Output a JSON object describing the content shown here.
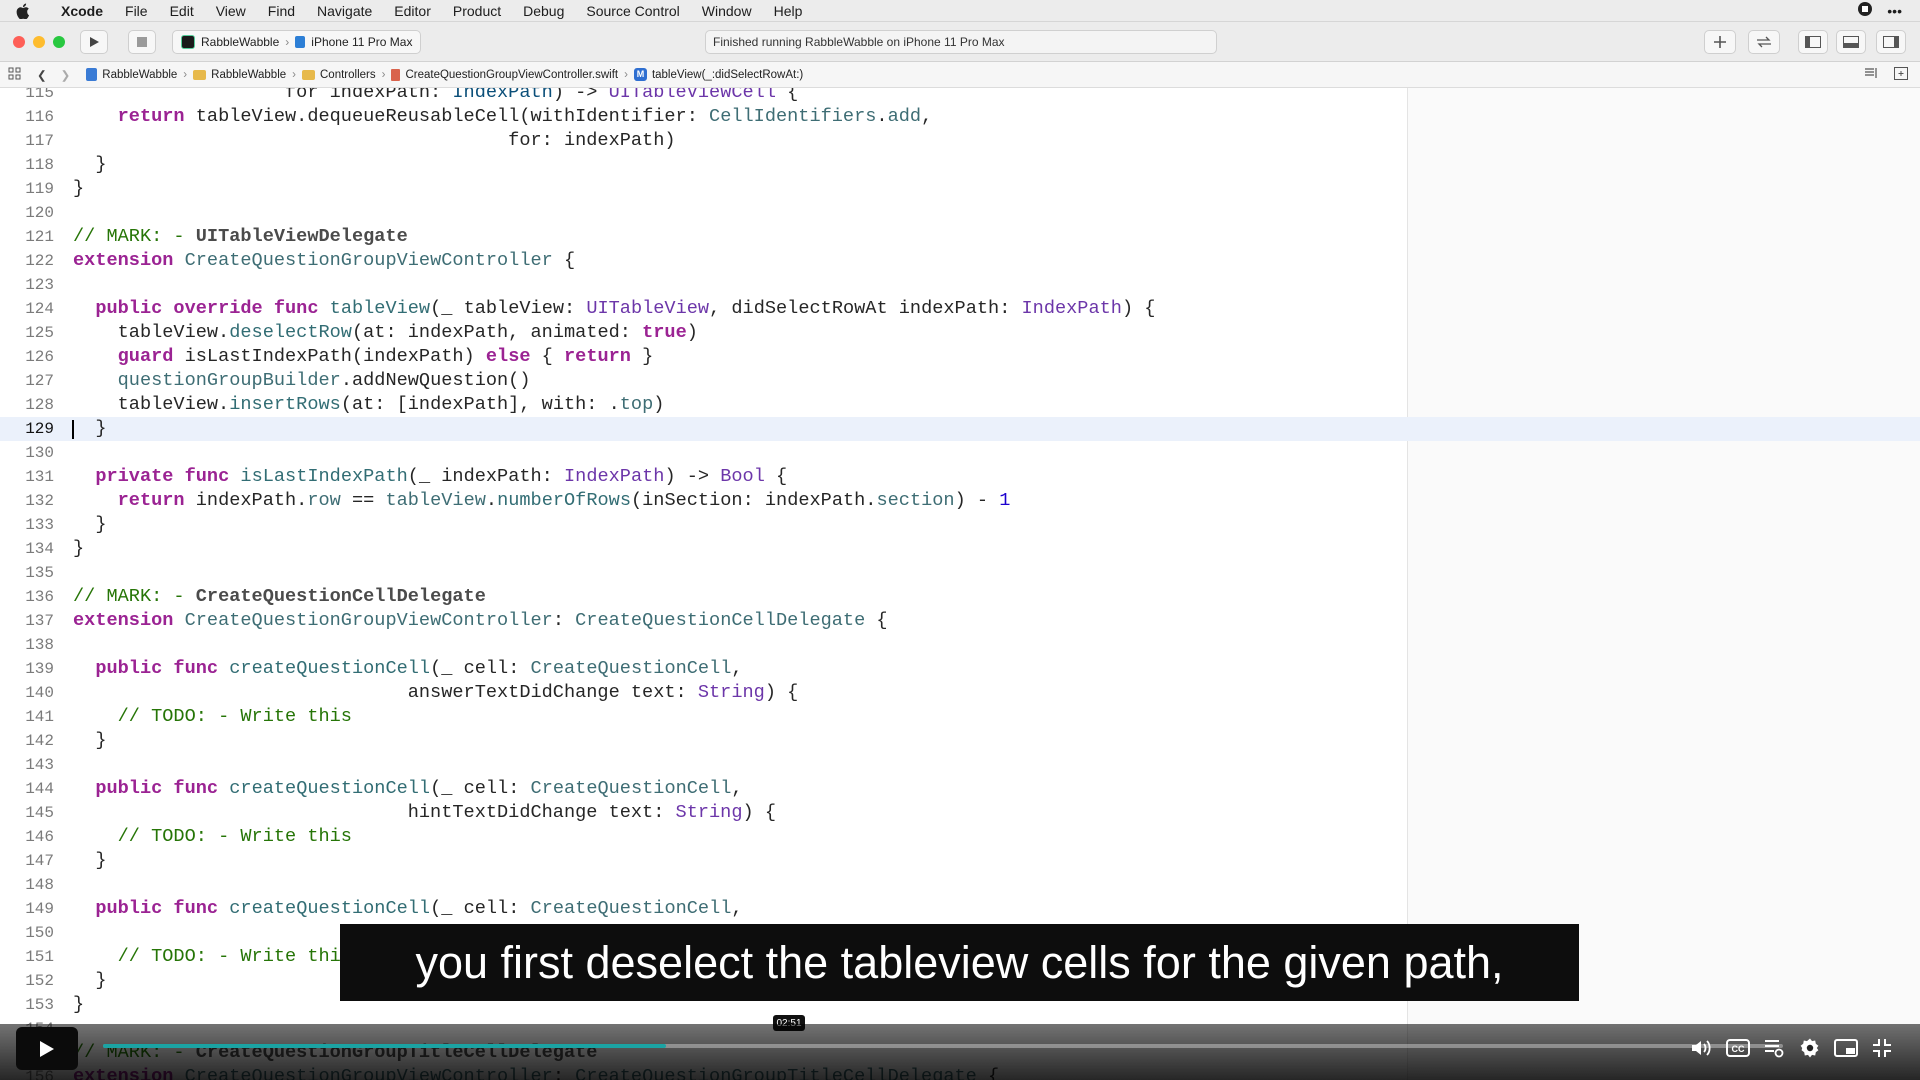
{
  "menubar": {
    "app_name": "Xcode",
    "items": [
      "File",
      "Edit",
      "View",
      "Find",
      "Navigate",
      "Editor",
      "Product",
      "Debug",
      "Source Control",
      "Window",
      "Help"
    ]
  },
  "toolbar": {
    "scheme_target": "RabbleWabble",
    "scheme_device": "iPhone 11 Pro Max",
    "status": "Finished running RabbleWabble on iPhone 11 Pro Max"
  },
  "jumpbar": {
    "crumbs": [
      "RabbleWabble",
      "RabbleWabble",
      "Controllers",
      "CreateQuestionGroupViewController.swift",
      "tableView(_:didSelectRowAt:)"
    ]
  },
  "editor": {
    "current_line": "129",
    "lines": [
      {
        "n": "115",
        "tokens": [
          [
            "",
            "                   for indexPath: "
          ],
          [
            "typ",
            "IndexPath"
          ],
          [
            "",
            ") -> "
          ],
          [
            "tyb",
            "UITableViewCell"
          ],
          [
            "",
            " {"
          ]
        ]
      },
      {
        "n": "116",
        "tokens": [
          [
            "",
            "    "
          ],
          [
            "kw",
            "return"
          ],
          [
            "",
            " tableView.dequeueReusableCell(withIdentifier: "
          ],
          [
            "ty",
            "CellIdentifiers"
          ],
          [
            "",
            "."
          ],
          [
            "ty",
            "add"
          ],
          [
            "",
            ","
          ]
        ]
      },
      {
        "n": "117",
        "tokens": [
          [
            "",
            "                                       for: indexPath)"
          ]
        ]
      },
      {
        "n": "118",
        "tokens": [
          [
            "",
            "  }"
          ]
        ]
      },
      {
        "n": "119",
        "tokens": [
          [
            "",
            "}"
          ]
        ]
      },
      {
        "n": "120",
        "tokens": [
          [
            "",
            ""
          ]
        ]
      },
      {
        "n": "121",
        "tokens": [
          [
            "cm",
            "// MARK: - "
          ],
          [
            "mk",
            "UITableViewDelegate"
          ]
        ]
      },
      {
        "n": "122",
        "tokens": [
          [
            "kw",
            "extension"
          ],
          [
            "",
            "",
            " "
          ],
          [
            "ty",
            " CreateQuestionGroupViewController"
          ],
          [
            "",
            " {"
          ]
        ]
      },
      {
        "n": "123",
        "tokens": [
          [
            "",
            ""
          ]
        ]
      },
      {
        "n": "124",
        "tokens": [
          [
            "",
            "  "
          ],
          [
            "kw",
            "public override func"
          ],
          [
            "",
            " "
          ],
          [
            "fn",
            "tableView"
          ],
          [
            "",
            "(_ tableView: "
          ],
          [
            "tyb",
            "UITableView"
          ],
          [
            "",
            ", didSelectRowAt indexPath: "
          ],
          [
            "tyb",
            "IndexPath"
          ],
          [
            "",
            ") {"
          ]
        ]
      },
      {
        "n": "125",
        "tokens": [
          [
            "",
            "    tableView."
          ],
          [
            "fn",
            "deselectRow"
          ],
          [
            "",
            "(at: indexPath, animated: "
          ],
          [
            "kw",
            "true"
          ],
          [
            "",
            ")"
          ]
        ]
      },
      {
        "n": "126",
        "tokens": [
          [
            "",
            "    "
          ],
          [
            "kw",
            "guard"
          ],
          [
            "",
            " isLastIndexPath(indexPath) "
          ],
          [
            "kw",
            "else"
          ],
          [
            "",
            " { "
          ],
          [
            "kw",
            "return"
          ],
          [
            "",
            " }"
          ]
        ]
      },
      {
        "n": "127",
        "tokens": [
          [
            "",
            "    "
          ],
          [
            "ty",
            "questionGroupBuilder"
          ],
          [
            "",
            ".addNewQuestion()"
          ]
        ]
      },
      {
        "n": "128",
        "tokens": [
          [
            "",
            "    tableView."
          ],
          [
            "fn",
            "insertRows"
          ],
          [
            "",
            "(at: [indexPath], with: ."
          ],
          [
            "ty",
            "top"
          ],
          [
            "",
            ")"
          ]
        ]
      },
      {
        "n": "129",
        "tokens": [
          [
            "",
            "  }"
          ]
        ]
      },
      {
        "n": "130",
        "tokens": [
          [
            "",
            ""
          ]
        ]
      },
      {
        "n": "131",
        "tokens": [
          [
            "",
            "  "
          ],
          [
            "kw",
            "private func"
          ],
          [
            "",
            " "
          ],
          [
            "fn",
            "isLastIndexPath"
          ],
          [
            "",
            "(_ indexPath: "
          ],
          [
            "tyb",
            "IndexPath"
          ],
          [
            "",
            ") -> "
          ],
          [
            "tyb",
            "Bool"
          ],
          [
            "",
            " {"
          ]
        ]
      },
      {
        "n": "132",
        "tokens": [
          [
            "",
            "    "
          ],
          [
            "kw",
            "return"
          ],
          [
            "",
            " indexPath."
          ],
          [
            "ty",
            "row"
          ],
          [
            "",
            " == "
          ],
          [
            "ty",
            "tableView"
          ],
          [
            "",
            "."
          ],
          [
            "fn",
            "numberOfRows"
          ],
          [
            "",
            "(inSection: indexPath."
          ],
          [
            "ty",
            "section"
          ],
          [
            "",
            ") - "
          ],
          [
            "num",
            "1"
          ]
        ]
      },
      {
        "n": "133",
        "tokens": [
          [
            "",
            "  }"
          ]
        ]
      },
      {
        "n": "134",
        "tokens": [
          [
            "",
            "}"
          ]
        ]
      },
      {
        "n": "135",
        "tokens": [
          [
            "",
            ""
          ]
        ]
      },
      {
        "n": "136",
        "tokens": [
          [
            "cm",
            "// MARK: - "
          ],
          [
            "mk",
            "CreateQuestionCellDelegate"
          ]
        ]
      },
      {
        "n": "137",
        "tokens": [
          [
            "kw",
            "extension"
          ],
          [
            "ty",
            " CreateQuestionGroupViewController"
          ],
          [
            "",
            ": "
          ],
          [
            "ty",
            "CreateQuestionCellDelegate"
          ],
          [
            "",
            " {"
          ]
        ]
      },
      {
        "n": "138",
        "tokens": [
          [
            "",
            ""
          ]
        ]
      },
      {
        "n": "139",
        "tokens": [
          [
            "",
            "  "
          ],
          [
            "kw",
            "public func"
          ],
          [
            "",
            " "
          ],
          [
            "fn",
            "createQuestionCell"
          ],
          [
            "",
            "(_ cell: "
          ],
          [
            "ty",
            "CreateQuestionCell"
          ],
          [
            "",
            ","
          ]
        ]
      },
      {
        "n": "140",
        "tokens": [
          [
            "",
            "                              answerTextDidChange text: "
          ],
          [
            "tyb",
            "String"
          ],
          [
            "",
            ") {"
          ]
        ]
      },
      {
        "n": "141",
        "tokens": [
          [
            "",
            "    "
          ],
          [
            "cm",
            "// TODO: - Write this"
          ]
        ]
      },
      {
        "n": "142",
        "tokens": [
          [
            "",
            "  }"
          ]
        ]
      },
      {
        "n": "143",
        "tokens": [
          [
            "",
            ""
          ]
        ]
      },
      {
        "n": "144",
        "tokens": [
          [
            "",
            "  "
          ],
          [
            "kw",
            "public func"
          ],
          [
            "",
            " "
          ],
          [
            "fn",
            "createQuestionCell"
          ],
          [
            "",
            "(_ cell: "
          ],
          [
            "ty",
            "CreateQuestionCell"
          ],
          [
            "",
            ","
          ]
        ]
      },
      {
        "n": "145",
        "tokens": [
          [
            "",
            "                              hintTextDidChange text: "
          ],
          [
            "tyb",
            "String"
          ],
          [
            "",
            ") {"
          ]
        ]
      },
      {
        "n": "146",
        "tokens": [
          [
            "",
            "    "
          ],
          [
            "cm",
            "// TODO: - Write this"
          ]
        ]
      },
      {
        "n": "147",
        "tokens": [
          [
            "",
            "  }"
          ]
        ]
      },
      {
        "n": "148",
        "tokens": [
          [
            "",
            ""
          ]
        ]
      },
      {
        "n": "149",
        "tokens": [
          [
            "",
            "  "
          ],
          [
            "kw",
            "public func"
          ],
          [
            "",
            " "
          ],
          [
            "fn",
            "createQuestionCell"
          ],
          [
            "",
            "(_ cell: "
          ],
          [
            "ty",
            "CreateQuestionCell"
          ],
          [
            "",
            ","
          ]
        ]
      },
      {
        "n": "150",
        "tokens": [
          [
            "",
            ""
          ]
        ]
      },
      {
        "n": "151",
        "tokens": [
          [
            "",
            "    "
          ],
          [
            "cm",
            "// TODO: - Write thi"
          ]
        ]
      },
      {
        "n": "152",
        "tokens": [
          [
            "",
            "  }"
          ]
        ]
      },
      {
        "n": "153",
        "tokens": [
          [
            "",
            "}"
          ]
        ]
      },
      {
        "n": "154",
        "tokens": [
          [
            "",
            ""
          ]
        ]
      },
      {
        "n": "155",
        "tokens": [
          [
            "cm",
            "// MARK: - "
          ],
          [
            "mk",
            "CreateQuestionGroupTitleCellDelegate"
          ]
        ]
      },
      {
        "n": "156",
        "tokens": [
          [
            "kw",
            "extension"
          ],
          [
            "ty",
            " CreateQuestionGroupViewController"
          ],
          [
            "",
            ": "
          ],
          [
            "ty",
            "CreateQuestionGroupTitleCellDelegate"
          ],
          [
            "",
            " {"
          ]
        ]
      }
    ]
  },
  "video": {
    "subtitle": "you first deselect the tableview cells for the given path,",
    "time": "02:51",
    "progress": 0.335,
    "accent": "#1ba3a3"
  },
  "colors": {
    "keyword": "#9b2393",
    "comment": "#267507",
    "type": "#3e6d74",
    "number": "#1c00cf"
  }
}
